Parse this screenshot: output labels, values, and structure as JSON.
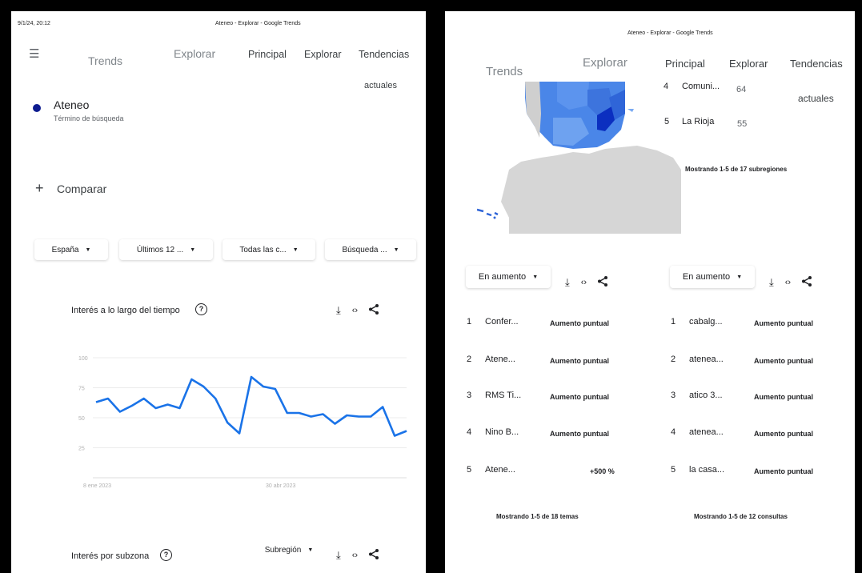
{
  "left": {
    "timestamp": "9/1/24, 20:12",
    "window_title": "Ateneo - Explorar - Google Trends",
    "nav": {
      "trends": "Trends",
      "explorar_faded": "Explorar",
      "principal": "Principal",
      "explorar": "Explorar",
      "tendencias": "Tendencias",
      "actuales": "actuales"
    },
    "term": {
      "name": "Ateneo",
      "sub": "Término de búsqueda",
      "color": "#0d1c8f"
    },
    "compare": {
      "plus": "+",
      "label": "Comparar"
    },
    "filters": [
      "España",
      "Últimos 12 ...",
      "Todas las c...",
      "Búsqueda ..."
    ],
    "interest_time": {
      "title": "Interés a lo largo del tiempo",
      "help": "?"
    },
    "interest_region": {
      "title": "Interés por subzona",
      "help": "?",
      "dropdown": "Subregión"
    }
  },
  "right": {
    "window_title": "Ateneo - Explorar - Google Trends",
    "nav": {
      "trends": "Trends",
      "explorar_faded": "Explorar",
      "principal": "Principal",
      "explorar": "Explorar",
      "tendencias": "Tendencias",
      "actuales": "actuales"
    },
    "regions_partial": [
      {
        "rank": "4",
        "name": "Comuni...",
        "value": "64"
      },
      {
        "rank": "5",
        "name": "La Rioja",
        "value": "55"
      }
    ],
    "regions_footer": "Mostrando 1-5 de 17 subregiones",
    "topics": {
      "dropdown": "En aumento",
      "rows": [
        {
          "rank": "1",
          "name": "Confer...",
          "value": "Aumento puntual"
        },
        {
          "rank": "2",
          "name": "Atene...",
          "value": "Aumento puntual"
        },
        {
          "rank": "3",
          "name": "RMS Ti...",
          "value": "Aumento puntual"
        },
        {
          "rank": "4",
          "name": "Nino B...",
          "value": "Aumento puntual"
        },
        {
          "rank": "5",
          "name": "Atene...",
          "value": "+500 %"
        }
      ],
      "footer": "Mostrando 1-5 de 18 temas"
    },
    "queries": {
      "dropdown": "En aumento",
      "rows": [
        {
          "rank": "1",
          "name": "cabalg...",
          "value": "Aumento puntual"
        },
        {
          "rank": "2",
          "name": "atenea...",
          "value": "Aumento puntual"
        },
        {
          "rank": "3",
          "name": "atico 3...",
          "value": "Aumento puntual"
        },
        {
          "rank": "4",
          "name": "atenea...",
          "value": "Aumento puntual"
        },
        {
          "rank": "5",
          "name": "la casa...",
          "value": "Aumento puntual"
        }
      ],
      "footer": "Mostrando 1-5 de 12 consultas"
    }
  },
  "chart_data": {
    "type": "line",
    "series": [
      {
        "values": [
          63,
          66,
          55,
          60,
          66,
          58,
          61,
          58,
          82,
          76,
          66,
          46,
          37,
          84,
          76,
          74,
          54,
          54,
          51,
          53,
          45,
          52,
          51,
          51,
          59,
          35,
          39
        ]
      }
    ],
    "x_tick_labels": [
      "8 ene 2023",
      "30 abr 2023"
    ],
    "y_ticks": [
      25,
      50,
      75,
      100
    ],
    "ylim": [
      0,
      100
    ],
    "grid": true,
    "line_color": "#1a73e8"
  }
}
